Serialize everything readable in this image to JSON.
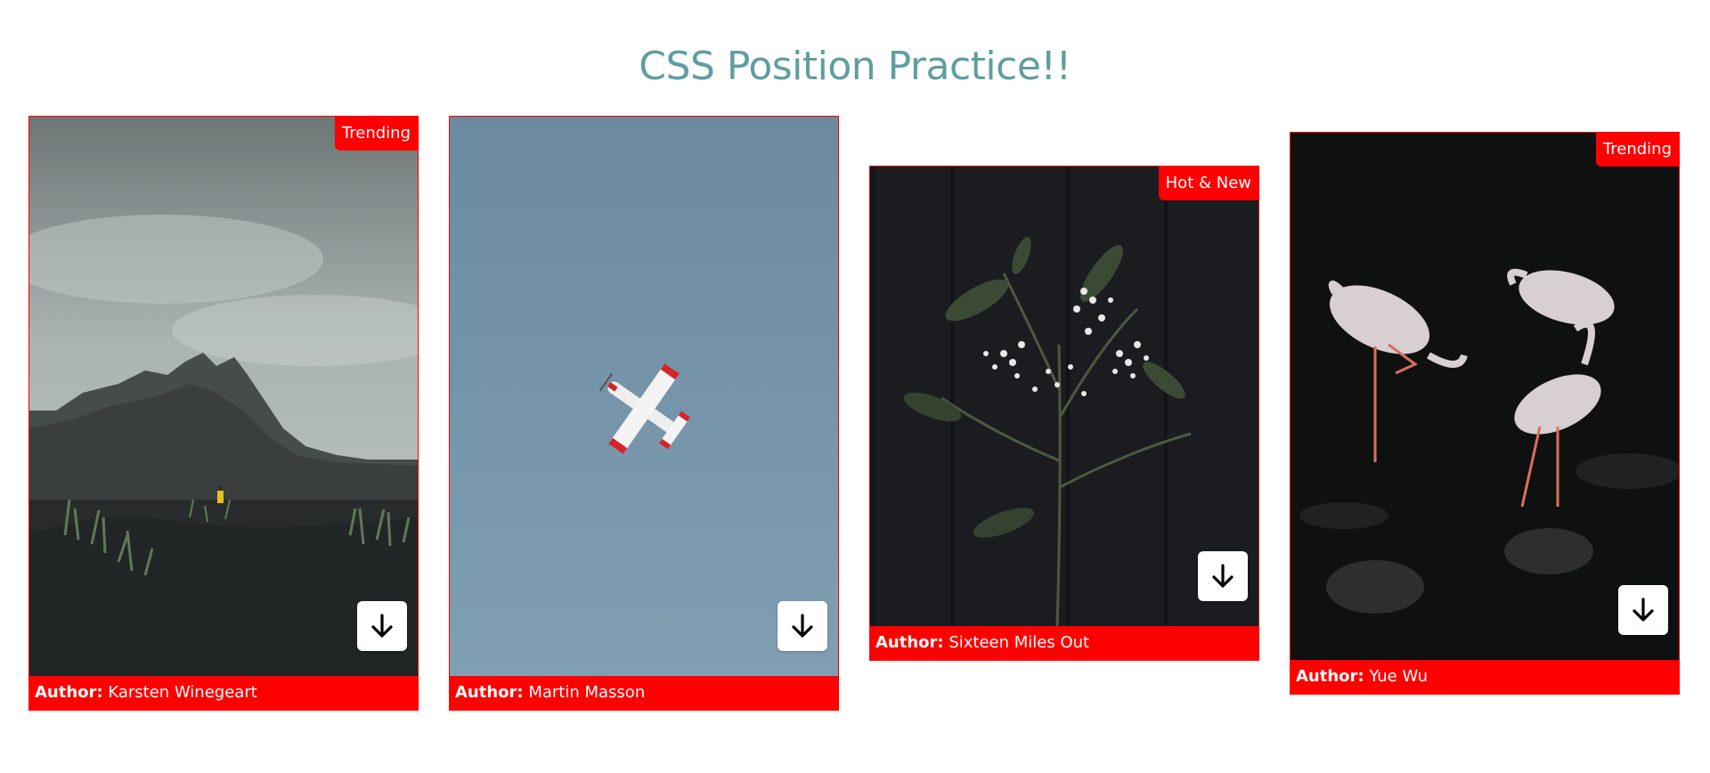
{
  "page": {
    "title": "CSS Position Practice!!",
    "accent_color": "#5f9ea0",
    "badge_color": "#ff0000"
  },
  "cards": [
    {
      "badge": "Trending",
      "author_label": "Author:",
      "author_name": "Karsten Winegeart",
      "photo_subject": "black-sand beach with mountains and person in yellow jacket",
      "button_icon": "arrow-down-icon"
    },
    {
      "badge": "",
      "author_label": "Author:",
      "author_name": "Martin Masson",
      "photo_subject": "small white and red airplane in blue sky",
      "button_icon": "arrow-down-icon"
    },
    {
      "badge": "Hot & New",
      "author_label": "Author:",
      "author_name": "Sixteen Miles Out",
      "photo_subject": "baby's breath flowers on dark wooden background",
      "button_icon": "arrow-down-icon"
    },
    {
      "badge": "Trending",
      "author_label": "Author:",
      "author_name": "Yue Wu",
      "photo_subject": "three flamingos standing in dark water",
      "button_icon": "arrow-down-icon"
    }
  ]
}
